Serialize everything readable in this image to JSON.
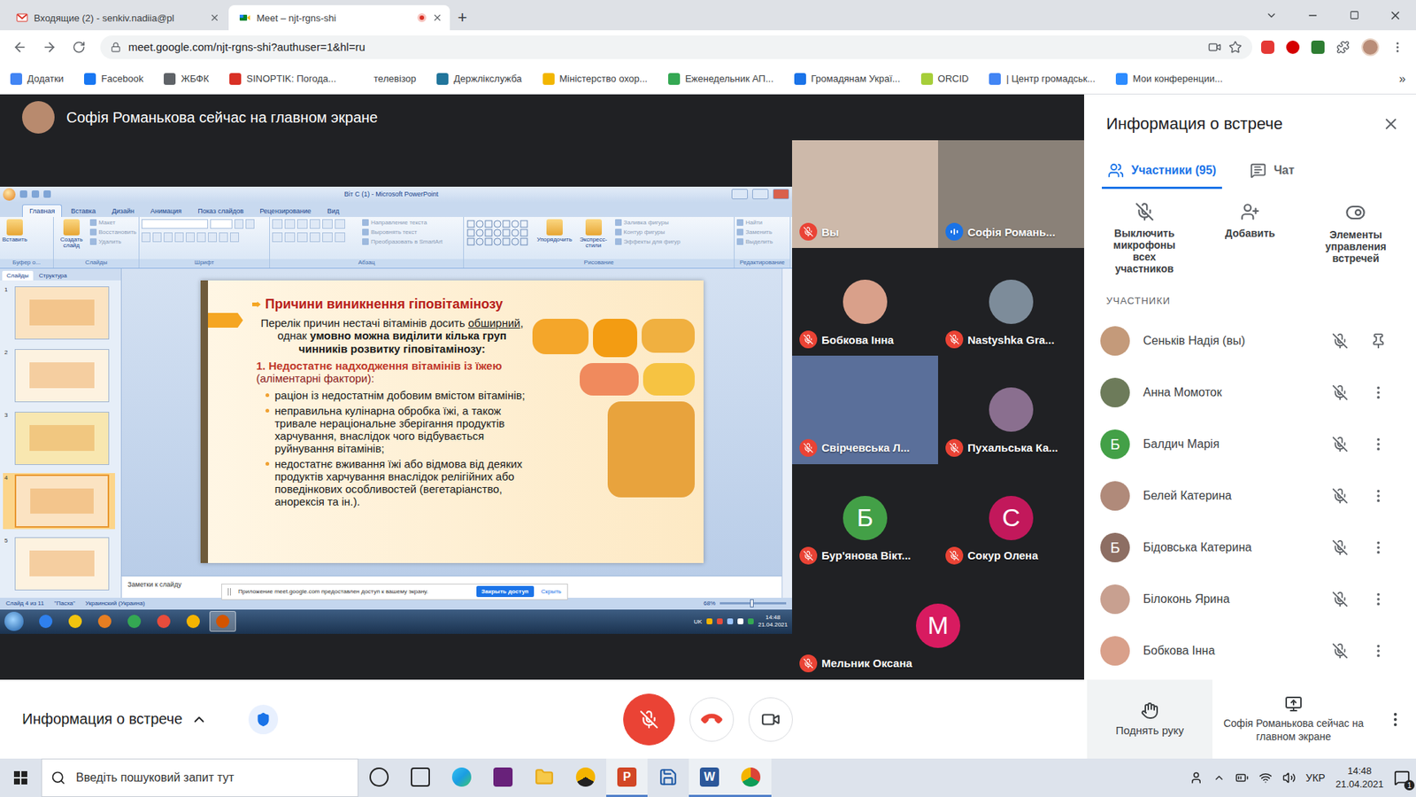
{
  "browser": {
    "tabs": [
      {
        "title": "Входящие (2) - senkiv.nadiia@pl",
        "kind": "gmail",
        "selected": false,
        "recording": false
      },
      {
        "title": "Meet – njt-rgns-shi",
        "kind": "meet",
        "selected": true,
        "recording": true
      }
    ],
    "new_tab": "+",
    "url": "meet.google.com/njt-rgns-shi?authuser=1&hl=ru",
    "bookmarks": [
      {
        "label": "Додатки",
        "color": "#4285f4"
      },
      {
        "label": "Facebook",
        "color": "#1877f2"
      },
      {
        "label": "ЖБФК",
        "color": "#5f6368"
      },
      {
        "label": "SINOPTIK: Погода...",
        "color": "#d93025"
      },
      {
        "label": "телевізор",
        "color": "#ffffff"
      },
      {
        "label": "Держлікслужба",
        "color": "#21759b"
      },
      {
        "label": "Міністерство охор...",
        "color": "#f2b600"
      },
      {
        "label": "Еженедельник АП...",
        "color": "#34a853"
      },
      {
        "label": "Громадянам Украї...",
        "color": "#1a73e8"
      },
      {
        "label": "ORCID",
        "color": "#a6ce39"
      },
      {
        "label": "| Центр громадськ...",
        "color": "#4285f4"
      },
      {
        "label": "Мои конференции...",
        "color": "#2d8cff"
      }
    ],
    "more_bookmarks": "»"
  },
  "meet": {
    "banner": "Софія Романькова сейчас на главном экране",
    "presentation": {
      "title": "Віт С (1) - Microsoft PowerPoint",
      "ribbon_tabs": [
        {
          "label": "Главная",
          "selected": true
        },
        {
          "label": "Вставка",
          "selected": false
        },
        {
          "label": "Дизайн",
          "selected": false
        },
        {
          "label": "Анимация",
          "selected": false
        },
        {
          "label": "Показ слайдов",
          "selected": false
        },
        {
          "label": "Рецензирование",
          "selected": false
        },
        {
          "label": "Вид",
          "selected": false
        }
      ],
      "ribbon_groups": [
        {
          "label": "Буфер о...",
          "kind": "buttons",
          "big": [
            "Вставить"
          ],
          "small": []
        },
        {
          "label": "Слайды",
          "kind": "buttons",
          "big": [
            "Создать слайд"
          ],
          "small": [
            "Макет",
            "Восстановить",
            "Удалить"
          ]
        },
        {
          "label": "Шрифт",
          "kind": "font",
          "big": [],
          "small": []
        },
        {
          "label": "Абзац",
          "kind": "paragraph",
          "big": [],
          "small": [
            "Направление текста",
            "Выровнять текст",
            "Преобразовать в SmartArt"
          ]
        },
        {
          "label": "Рисование",
          "kind": "drawing",
          "big": [
            "Упорядочить",
            "Экспресс-стили"
          ],
          "small": [
            "Заливка фигуры",
            "Контур фигуры",
            "Эффекты для фигур"
          ]
        },
        {
          "label": "Редактирование",
          "kind": "buttons",
          "big": [],
          "small": [
            "Найти",
            "Заменить",
            "Выделить"
          ]
        }
      ],
      "slides_pane": {
        "tabs": [
          {
            "label": "Слайды",
            "selected": true
          },
          {
            "label": "Структура",
            "selected": false
          }
        ],
        "thumbnails": [
          {
            "number": "1",
            "selected": false,
            "color": "#fbe3c2"
          },
          {
            "number": "2",
            "selected": false,
            "color": "#fdf2e0"
          },
          {
            "number": "3",
            "selected": false,
            "color": "#f8e7b0"
          },
          {
            "number": "4",
            "selected": true,
            "color": "#fbe3c2"
          },
          {
            "number": "5",
            "selected": false,
            "color": "#fdf2e0"
          }
        ]
      },
      "slide": {
        "title": "Причини виникнення гіповітамінозу",
        "intro": [
          {
            "text": "Перелік причин нестачі вітамінів досить ",
            "bold": false,
            "underline": false
          },
          {
            "text": "обширний",
            "bold": false,
            "underline": true
          },
          {
            "text": ", однак ",
            "bold": false,
            "underline": false
          },
          {
            "text": "умовно можна виділити кілька груп чинників розвитку гіповітамінозу:",
            "bold": true,
            "underline": false
          }
        ],
        "heading": "1. Недостатнє надходження вітамінів із їжею",
        "heading_note": "(аліментарні фактори):",
        "bullets": [
          "раціон із недостатнім добовим вмістом вітамінів;",
          "неправильна кулінарна обробка їжі, а також тривале нераціональне зберігання продуктів харчування, внаслідок чого відбувається руйнування вітамінів;",
          "недостатнє вживання їжі або відмова від деяких продуктів харчування внаслідок релігійних або поведінкових особливостей (вегетаріанство, анорексія та ін.)."
        ],
        "pictures": [
          {
            "color": "#f4a62a"
          },
          {
            "color": "#f39c12"
          },
          {
            "color": "#f0b040"
          },
          {
            "color": "#f08a5d"
          },
          {
            "color": "#f6c342"
          },
          {
            "color": "#e8a33d"
          }
        ]
      },
      "notes": "Заметки к слайду",
      "share_bar": {
        "message": "Приложение meet.google.com предоставлен доступ к вашему экрану.",
        "stop": "Закрыть доступ",
        "hide": "Скрыть"
      },
      "status": {
        "slide": "Слайд 4 из 11",
        "theme": "\"Пасха\"",
        "language": "Украинский (Украина)",
        "zoom": "68%",
        "zoom_level": 0.45
      },
      "inner_taskbar": {
        "lang": "UK",
        "time": "14:48",
        "date": "21.04.2021",
        "apps": [
          {
            "color": "#2f80ed",
            "selected": false
          },
          {
            "color": "#f1c40f",
            "selected": false
          },
          {
            "color": "#e67e22",
            "selected": false
          },
          {
            "color": "#34a853",
            "selected": false
          },
          {
            "color": "#e74c3c",
            "selected": false
          },
          {
            "color": "#f4b400",
            "selected": false
          },
          {
            "color": "#d35400",
            "selected": true
          }
        ]
      }
    },
    "tiles": [
      {
        "name": "Вы",
        "kind": "video",
        "muted": true,
        "speaking": false,
        "color": "#cdb9aa"
      },
      {
        "name": "Софія Романь...",
        "kind": "video",
        "muted": false,
        "speaking": true,
        "color": "#8a8178"
      },
      {
        "name": "Бобкова Інна",
        "kind": "photo",
        "muted": true,
        "speaking": false,
        "color": "#d9a08a"
      },
      {
        "name": "Nastyshka Gra...",
        "kind": "photo",
        "muted": true,
        "speaking": false,
        "color": "#7d8c9a"
      },
      {
        "name": "Свірчевська Л...",
        "kind": "video",
        "muted": true,
        "speaking": false,
        "color": "#5a6f9a"
      },
      {
        "name": "Пухальська Ка...",
        "kind": "photo",
        "muted": true,
        "speaking": false,
        "color": "#8a6f8f"
      },
      {
        "name": "Бур'янова Вікт...",
        "kind": "letter",
        "letter": "Б",
        "muted": true,
        "speaking": false,
        "color": "#43a047"
      },
      {
        "name": "Сокур Олена",
        "kind": "letter",
        "letter": "С",
        "muted": true,
        "speaking": false,
        "color": "#c2185b"
      },
      {
        "name": "Мельник Оксана",
        "kind": "letter",
        "letter": "М",
        "muted": true,
        "speaking": false,
        "color": "#d81b60"
      }
    ],
    "side_panel": {
      "title": "Информация о встрече",
      "tabs": [
        {
          "label": "Участники (95)",
          "kind": "people",
          "selected": true
        },
        {
          "label": "Чат",
          "kind": "chat",
          "selected": false
        }
      ],
      "actions": [
        {
          "label": "Выключить микрофоны всех участников",
          "kind": "mute"
        },
        {
          "label": "Добавить",
          "kind": "add"
        },
        {
          "label": "Элементы управления встречей",
          "kind": "controls"
        }
      ],
      "section": "УЧАСТНИКИ",
      "people": [
        {
          "name": "Сеньків Надія (вы)",
          "kind": "photo",
          "color": "#c49a7a",
          "muted": true,
          "self": true
        },
        {
          "name": "Анна Момоток",
          "kind": "photo",
          "color": "#6d7b5a",
          "muted": true,
          "self": false
        },
        {
          "name": "Балдич Марія",
          "kind": "letter",
          "letter": "Б",
          "color": "#43a047",
          "muted": true,
          "self": false
        },
        {
          "name": "Белей Катерина",
          "kind": "photo",
          "color": "#b08a7a",
          "muted": true,
          "self": false
        },
        {
          "name": "Бідовська Катерина",
          "kind": "letter",
          "letter": "Б",
          "color": "#8d6e63",
          "muted": true,
          "self": false
        },
        {
          "name": "Білоконь Ярина",
          "kind": "photo",
          "color": "#c8a090",
          "muted": true,
          "self": false
        },
        {
          "name": "Бобкова Інна",
          "kind": "photo",
          "color": "#d9a08a",
          "muted": true,
          "self": false
        }
      ]
    },
    "controls": {
      "info": "Информация о встрече",
      "mic_muted": true,
      "camera_on": true,
      "raise_hand": "Поднять руку",
      "presenting": "Софія Романькова сейчас на главном экране"
    }
  },
  "taskbar": {
    "search": "Введіть пошуковий запит тут",
    "apps": [
      {
        "kind": "cortana",
        "selected": false
      },
      {
        "kind": "taskview",
        "selected": false
      },
      {
        "kind": "edge",
        "selected": false
      },
      {
        "kind": "vs",
        "selected": false
      },
      {
        "kind": "folder",
        "selected": false
      },
      {
        "kind": "triangle",
        "selected": false
      },
      {
        "kind": "powerpoint",
        "letter": "P",
        "selected": true
      },
      {
        "kind": "save",
        "selected": false
      },
      {
        "kind": "word",
        "letter": "W",
        "selected": true
      },
      {
        "kind": "chrome",
        "selected": true
      }
    ],
    "lang": "УКР",
    "time": "14:48",
    "date": "21.04.2021",
    "notifications": "1"
  }
}
